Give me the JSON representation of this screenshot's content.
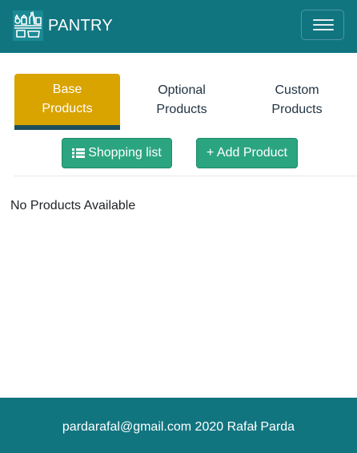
{
  "navbar": {
    "brand_name": "PANTRY",
    "logo_icon": "pantry-shelf-icon",
    "menu_icon": "hamburger-menu-icon",
    "background": "#117580"
  },
  "tabs": [
    {
      "label": "Base Products",
      "active": true
    },
    {
      "label": "Optional Products",
      "active": false
    },
    {
      "label": "Custom Products",
      "active": false
    }
  ],
  "actions": {
    "shopping_list_label": "Shopping list",
    "shopping_list_icon": "list-icon",
    "add_product_label": "+ Add Product",
    "button_color": "#2ba57f"
  },
  "content": {
    "empty_message": "No Products Available"
  },
  "footer": {
    "text": "pardarafal@gmail.com 2020 Rafał Parda"
  },
  "colors": {
    "accent": "#d9a300",
    "tab_indicator": "#1c4f5a"
  }
}
